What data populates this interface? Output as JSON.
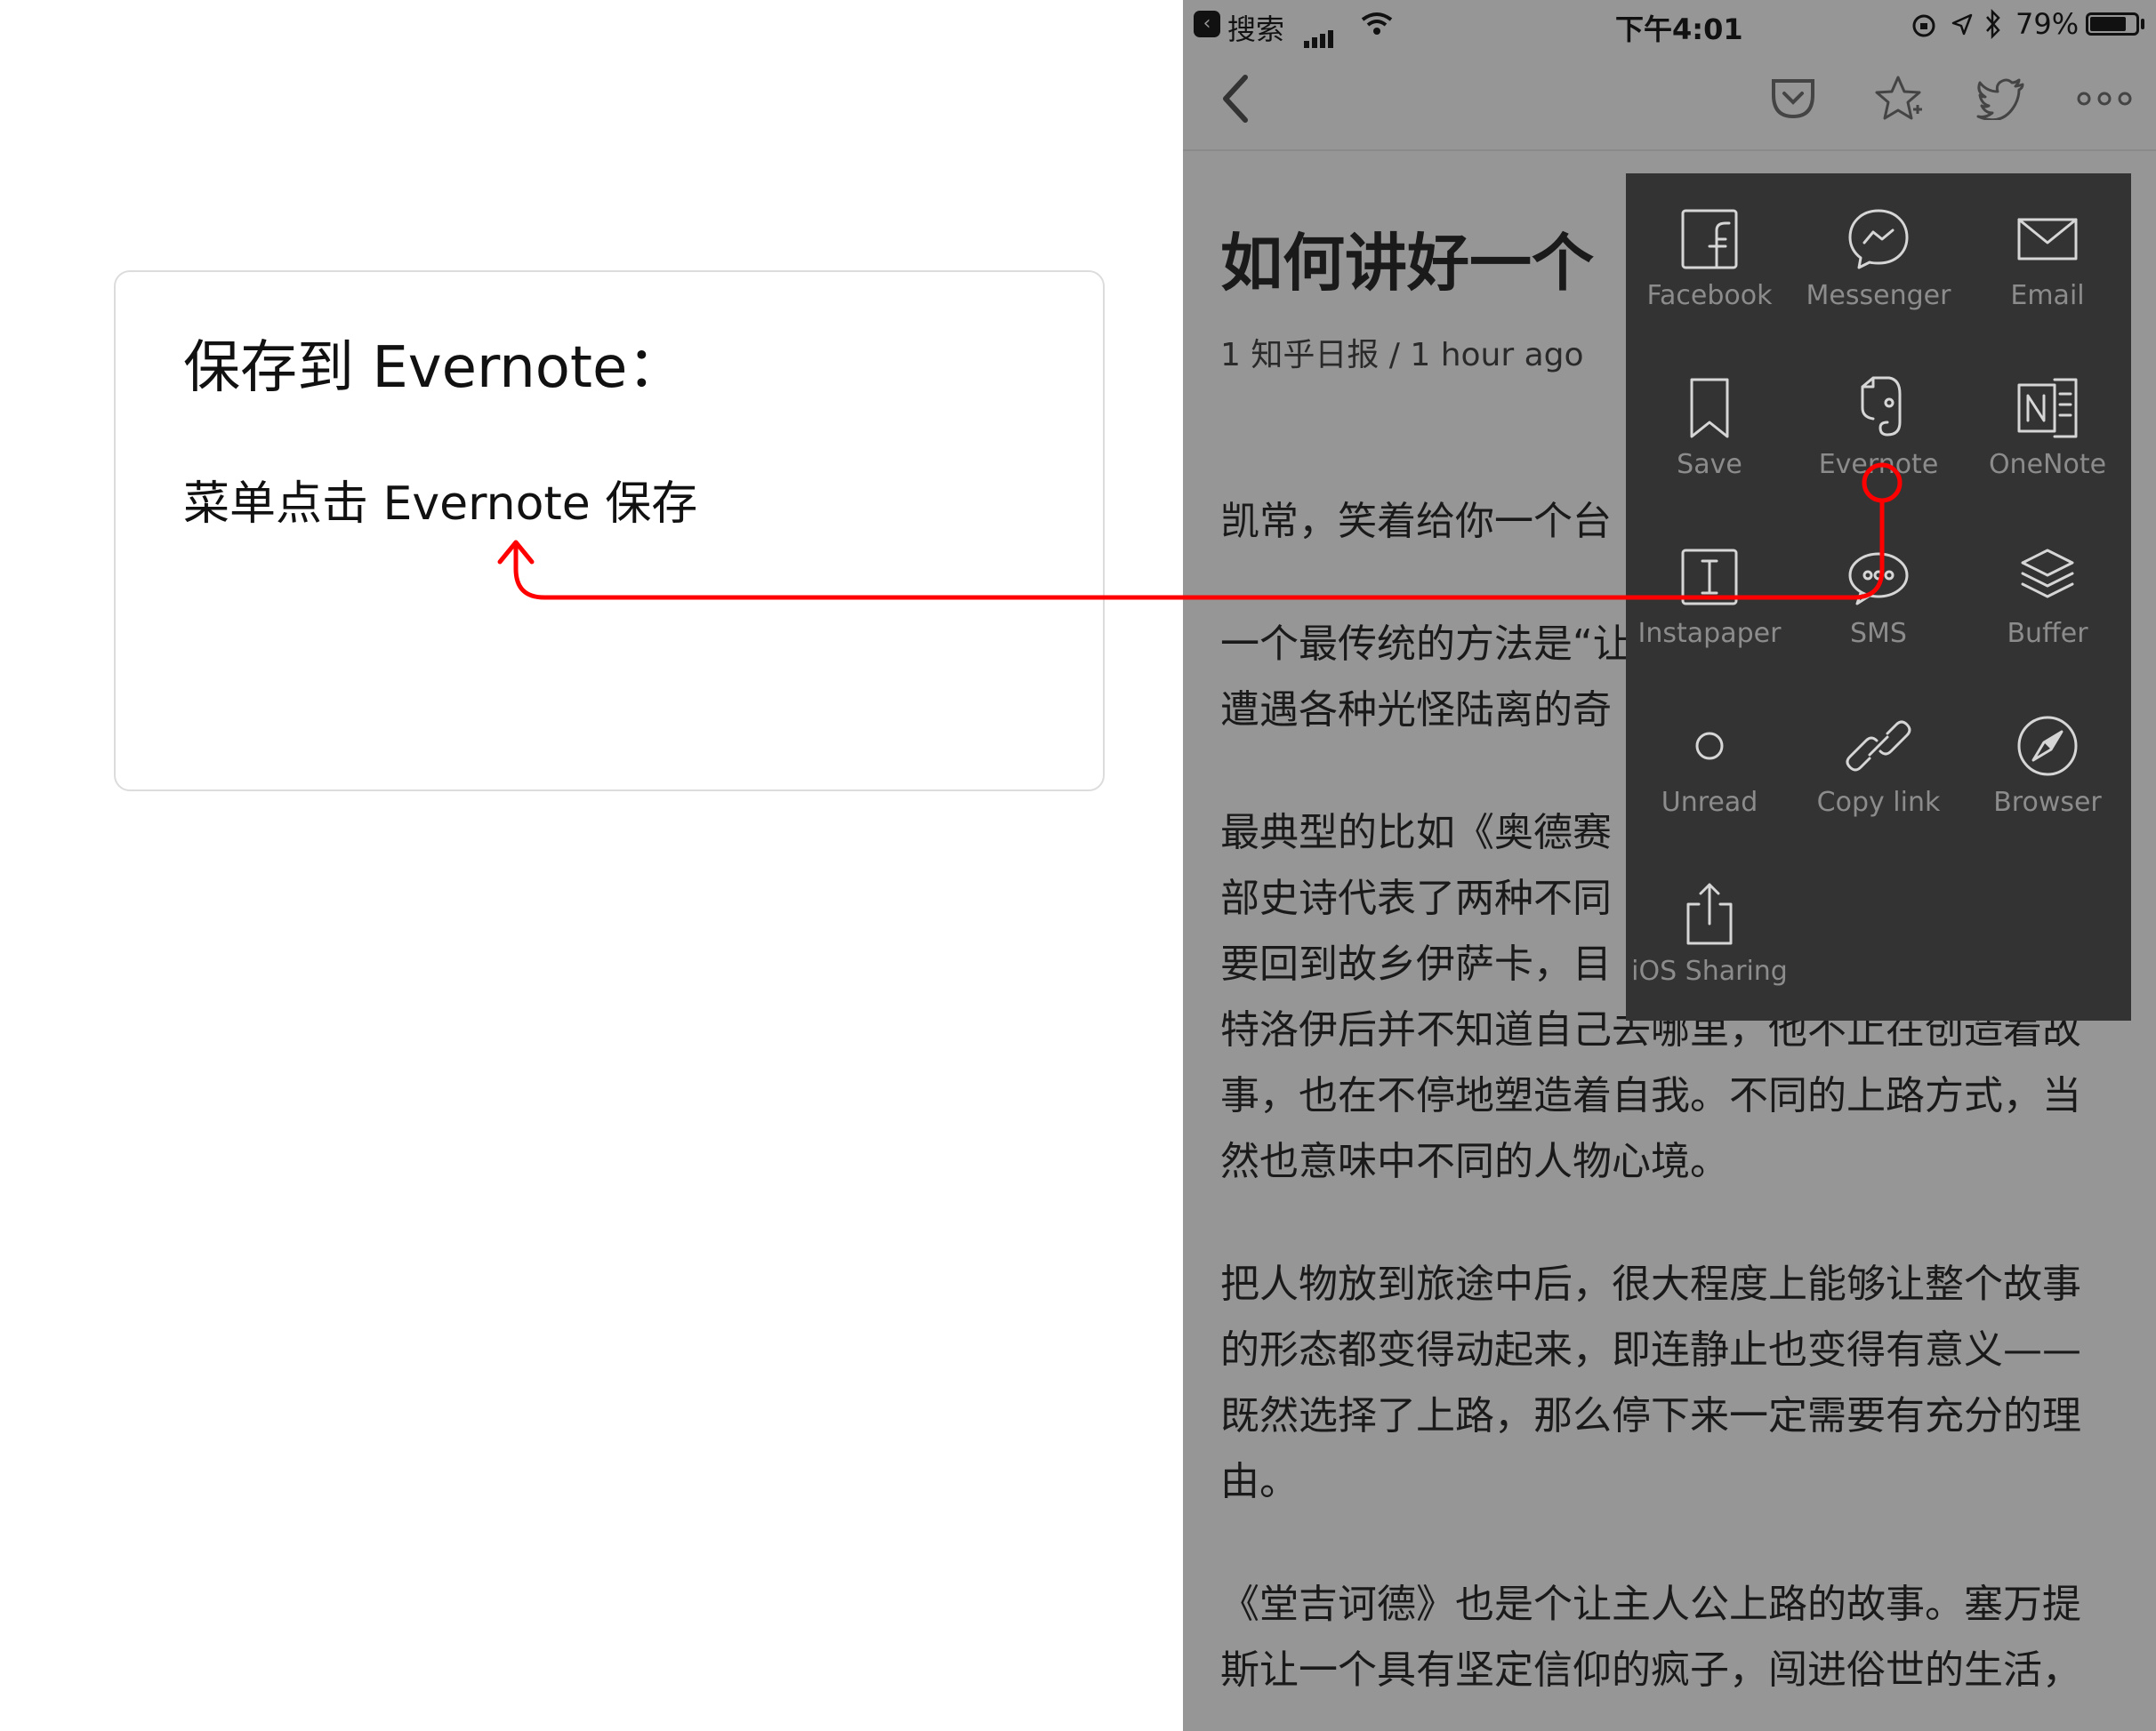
{
  "note": {
    "title": "保存到 Evernote：",
    "step": "菜单点击 Evernote 保存"
  },
  "status_bar": {
    "back_app": "搜索",
    "time": "下午4:01",
    "battery": "79%",
    "battery_level": 0.79
  },
  "nav": {
    "icons": [
      "chevron-left-icon",
      "pocket-icon",
      "star-icon",
      "twitter-icon",
      "more-icon"
    ]
  },
  "article": {
    "title": "如何讲好一个",
    "meta": "1 知乎日报 / 1 hour ago",
    "paragraphs": [
      "凯常，笑着给你一个台",
      "一个最传统的方法是“让\n遭遇各种光怪陆离的奇",
      "最典型的比如《奥德赛\n部史诗代表了两种不同\n要回到故乡伊萨卡，目\n特洛伊后并不知道自己去哪里，他不止在创造着故\n事，也在不停地塑造着自我。不同的上路方式，当\n然也意味中不同的人物心境。",
      "把人物放到旅途中后，很大程度上能够让整个故事\n的形态都变得动起来，即连静止也变得有意义——\n既然选择了上路，那么停下来一定需要有充分的理\n由。",
      "《堂吉诃德》也是个让主人公上路的故事。塞万提\n斯让一个具有坚定信仰的疯子，闯进俗世的生活，"
    ]
  },
  "share_menu": {
    "items": [
      {
        "label": "Facebook",
        "icon": "facebook-icon"
      },
      {
        "label": "Messenger",
        "icon": "messenger-icon"
      },
      {
        "label": "Email",
        "icon": "email-icon"
      },
      {
        "label": "Save",
        "icon": "bookmark-icon"
      },
      {
        "label": "Evernote",
        "icon": "evernote-icon"
      },
      {
        "label": "OneNote",
        "icon": "onenote-icon"
      },
      {
        "label": "Instapaper",
        "icon": "instapaper-icon"
      },
      {
        "label": "SMS",
        "icon": "sms-icon"
      },
      {
        "label": "Buffer",
        "icon": "buffer-icon"
      },
      {
        "label": "Unread",
        "icon": "circle-icon"
      },
      {
        "label": "Copy link",
        "icon": "link-icon"
      },
      {
        "label": "Browser",
        "icon": "compass-icon"
      },
      {
        "label": "iOS Sharing",
        "icon": "share-icon"
      }
    ]
  },
  "colors": {
    "annotation": "#ff0000",
    "menu_bg": "#333333",
    "menu_label": "#8c8c8c",
    "screen_dim": "#969696"
  }
}
